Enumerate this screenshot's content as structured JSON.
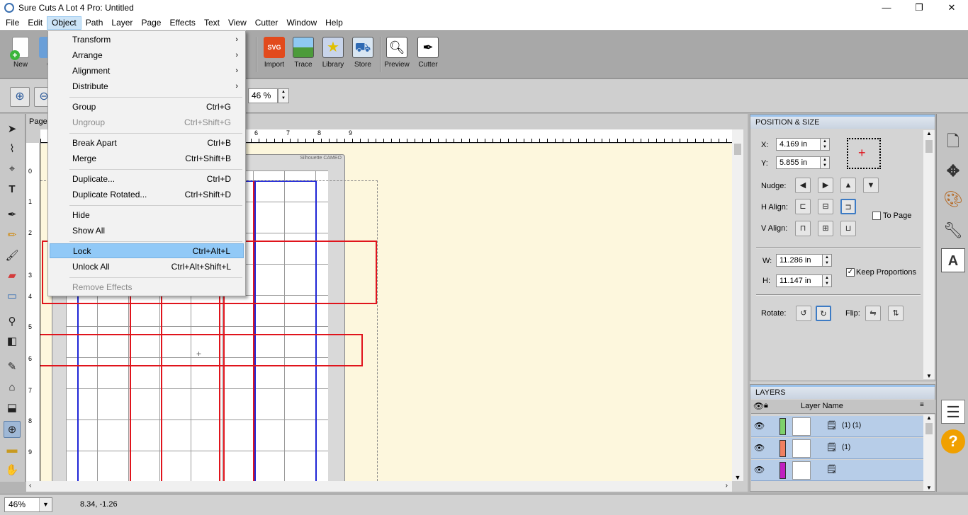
{
  "window": {
    "title": "Sure Cuts A Lot 4 Pro: Untitled",
    "controls": [
      "—",
      "❐",
      "✕"
    ]
  },
  "menubar": [
    "File",
    "Edit",
    "Object",
    "Path",
    "Layer",
    "Page",
    "Effects",
    "Text",
    "View",
    "Cutter",
    "Window",
    "Help"
  ],
  "toolbar": {
    "new": "New",
    "open": "O",
    "import": "Import",
    "trace": "Trace",
    "library": "Library",
    "store": "Store",
    "preview": "Preview",
    "cutter": "Cutter"
  },
  "zoombar": {
    "value": "46 %"
  },
  "canvas": {
    "page_tab": "Page",
    "mat_label": "Silhouette CAMEO",
    "ruler_top": [
      "6",
      "7",
      "8",
      "9"
    ],
    "ruler_left": [
      "0",
      "1",
      "2",
      "3",
      "4",
      "5",
      "6",
      "7",
      "8",
      "9"
    ]
  },
  "position_size": {
    "title": "POSITION & SIZE",
    "x_label": "X:",
    "x_value": "4.169 in",
    "y_label": "Y:",
    "y_value": "5.855 in",
    "nudge_label": "Nudge:",
    "halign_label": "H Align:",
    "valign_label": "V Align:",
    "to_page_label": "To Page",
    "to_page_checked": false,
    "w_label": "W:",
    "w_value": "11.286 in",
    "h_label": "H:",
    "h_value": "11.147 in",
    "keep_proportions_label": "Keep Proportions",
    "keep_proportions_checked": true,
    "rotate_label": "Rotate:",
    "flip_label": "Flip:"
  },
  "layers": {
    "title": "LAYERS",
    "column_name": "Layer Name",
    "rows": [
      {
        "name": "(1) (1)",
        "color": "#7ed16b"
      },
      {
        "name": "(1)",
        "color": "#f08060"
      },
      {
        "name": "",
        "color": "#c020c0"
      }
    ]
  },
  "status": {
    "zoom": "46%",
    "coords": "8.34, -1.26"
  },
  "object_menu": {
    "transform": "Transform",
    "arrange": "Arrange",
    "alignment": "Alignment",
    "distribute": "Distribute",
    "group": "Group",
    "group_sc": "Ctrl+G",
    "ungroup": "Ungroup",
    "ungroup_sc": "Ctrl+Shift+G",
    "break_apart": "Break Apart",
    "break_apart_sc": "Ctrl+B",
    "merge": "Merge",
    "merge_sc": "Ctrl+Shift+B",
    "duplicate": "Duplicate...",
    "duplicate_sc": "Ctrl+D",
    "duplicate_rotated": "Duplicate Rotated...",
    "duplicate_rotated_sc": "Ctrl+Shift+D",
    "hide": "Hide",
    "show_all": "Show All",
    "lock": "Lock",
    "lock_sc": "Ctrl+Alt+L",
    "unlock_all": "Unlock All",
    "unlock_all_sc": "Ctrl+Alt+Shift+L",
    "remove_effects": "Remove Effects"
  },
  "icons": [
    "pencil-app-icon",
    "arrow-select-icon",
    "node-edit-icon",
    "text-icon",
    "pen-icon",
    "pencil-icon",
    "brush-icon",
    "eraser-icon",
    "rectangle-icon",
    "eyedropper-icon",
    "gradient-icon",
    "knife-icon",
    "crop-icon",
    "weld-icon",
    "zoom-icon",
    "ruler-icon",
    "hand-icon",
    "document-icon",
    "move-icon",
    "palette-icon",
    "wrench-icon",
    "font-icon",
    "layers-icon",
    "help-icon"
  ]
}
